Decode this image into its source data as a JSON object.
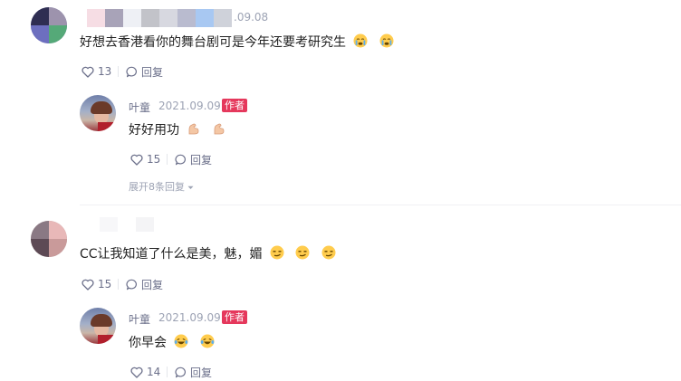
{
  "comments": [
    {
      "user_name": "",
      "date_partial": ".09.08",
      "text": "好想去香港看你的舞台剧可是今年还要考研究生",
      "emojis": [
        "crying-face",
        "crying-face"
      ],
      "likes": "13",
      "reply_label": "回复",
      "reply": {
        "user_name": "叶童",
        "date": "2021.09.09",
        "badge": "作者",
        "text": "好好用功",
        "emojis": [
          "flexed-biceps",
          "flexed-biceps"
        ],
        "likes": "15",
        "reply_label": "回复"
      },
      "expand_label": "展开8条回复"
    },
    {
      "user_name": "",
      "text": "CC让我知道了什么是美，魅，媚",
      "emojis": [
        "smirking-face",
        "smirking-face",
        "smirking-face"
      ],
      "likes": "15",
      "reply_label": "回复",
      "reply": {
        "user_name": "叶童",
        "date": "2021.09.09",
        "badge": "作者",
        "text": "你早会",
        "emojis": [
          "laughing-tears-face",
          "laughing-tears-face"
        ],
        "likes": "14",
        "reply_label": "回复"
      }
    }
  ],
  "colors": {
    "accent_badge": "#e5385c",
    "meta_text": "#6b6f8a",
    "secondary_text": "#9da3b4"
  }
}
